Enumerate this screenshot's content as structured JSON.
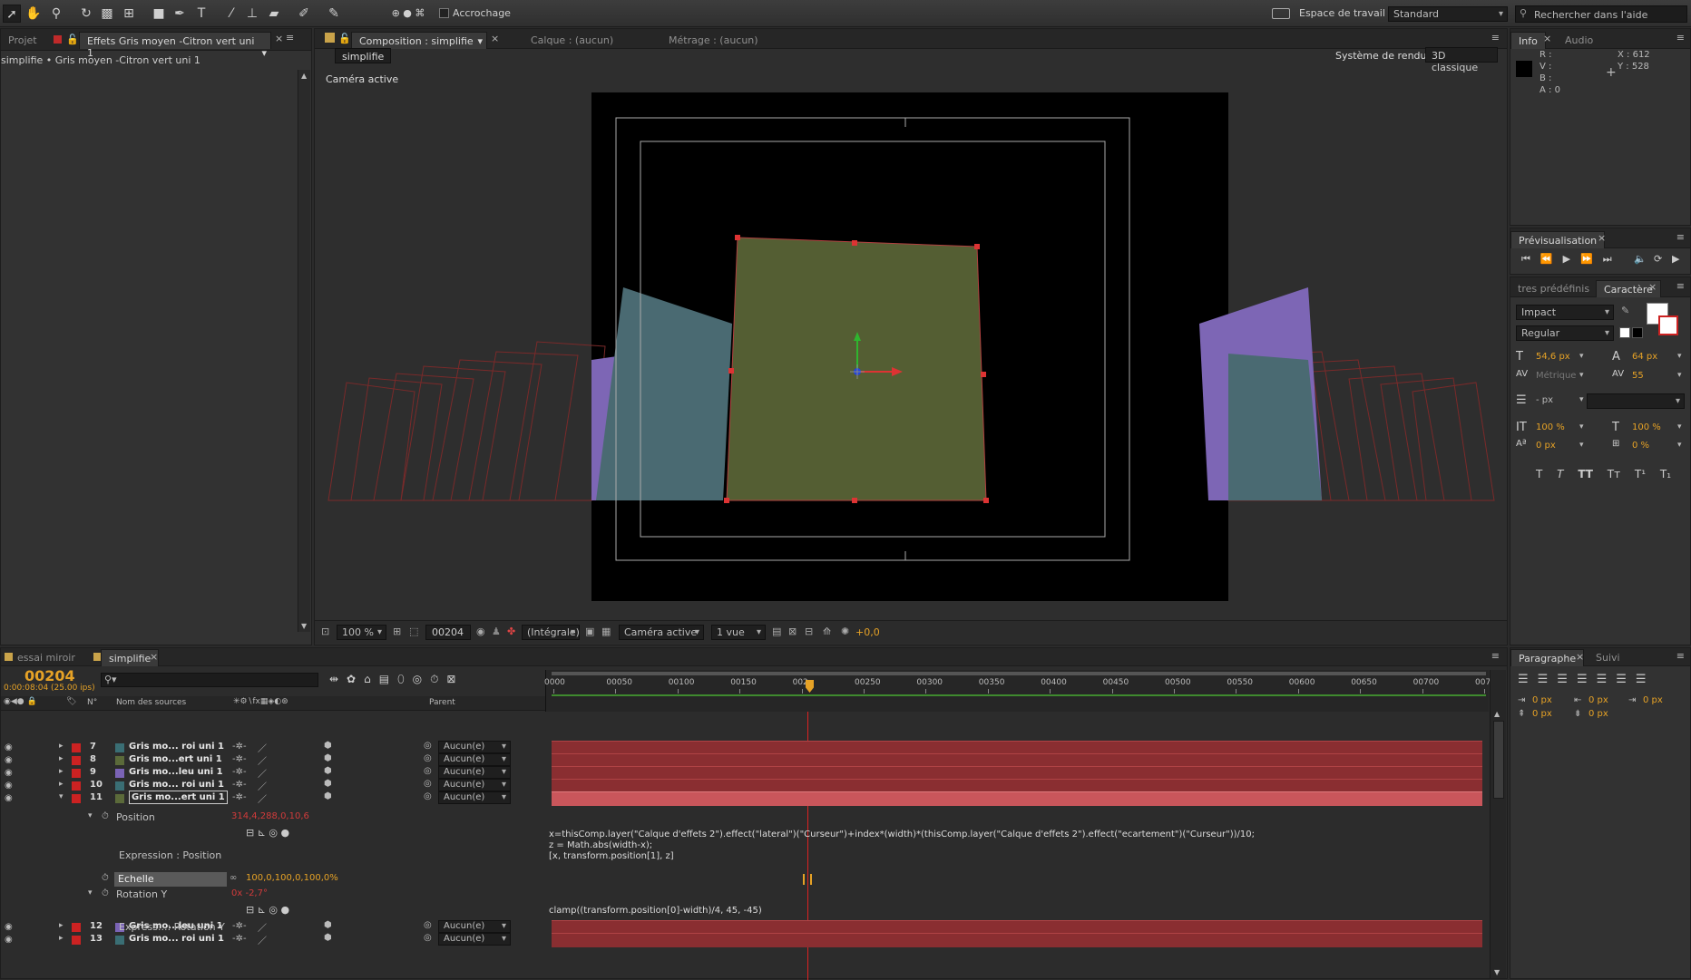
{
  "toolbar": {
    "snap_label": "Accrochage",
    "workspace_label": "Espace de travail :",
    "workspace_value": "Standard",
    "help_placeholder": "Rechercher dans l'aide"
  },
  "project": {
    "tab_projet": "Projet",
    "tab_effects": "Effets Gris moyen -Citron vert uni 1",
    "breadcrumb": "simplifie • Gris moyen -Citron vert uni 1"
  },
  "comp": {
    "tab_comp": "Composition : simplifie",
    "tab_layer": "Calque : (aucun)",
    "tab_footage": "Métrage : (aucun)",
    "subtab": "simplifie",
    "renderer_label": "Système de rendu :",
    "renderer_value": "3D classique",
    "camera_label": "Caméra active",
    "footer": {
      "zoom": "100 %",
      "timecode": "00204",
      "resolution": "(Intégrale)",
      "camera": "Caméra active",
      "views": "1 vue",
      "exposure": "+0,0"
    }
  },
  "info": {
    "tab_info": "Info",
    "tab_audio": "Audio",
    "r": "R :",
    "v": "V :",
    "b": "B :",
    "a": "A : 0",
    "x": "X : 612",
    "y": "Y : 528"
  },
  "preview": {
    "tab": "Prévisualisation"
  },
  "character": {
    "tab_presets": "tres prédéfinis",
    "tab_char": "Caractère",
    "font": "Impact",
    "style": "Regular",
    "size": "54,6 px",
    "leading": "64 px",
    "kerning": "Métrique",
    "tracking": "55",
    "stroke": "- px",
    "vscale": "100 %",
    "hscale": "100 %",
    "baseline": "0 px",
    "tsume": "0 %"
  },
  "paragraph": {
    "tab": "Paragraphe",
    "tab_suivi": "Suivi",
    "indent1": "0 px",
    "indent2": "0 px",
    "indent3": "0 px",
    "space1": "0 px",
    "space2": "0 px"
  },
  "timeline": {
    "tab_essai": "essai miroir",
    "tab_simplifie": "simplifie",
    "timecode": "00204",
    "timecode_sub": "0:00:08:04 (25.00 ips)",
    "col_num": "N°",
    "col_name": "Nom des sources",
    "col_parent": "Parent",
    "ruler": [
      "0000",
      "00050",
      "00100",
      "00150",
      "002",
      "00250",
      "00300",
      "00350",
      "00400",
      "00450",
      "00500",
      "00550",
      "00600",
      "00650",
      "00700",
      "0075"
    ],
    "layers": [
      {
        "num": "7",
        "name": "Gris mo... roi uni 1",
        "color": "#3a6e74",
        "parent": "Aucun(e)"
      },
      {
        "num": "8",
        "name": "Gris mo...ert uni 1",
        "color": "#5b6a3a",
        "parent": "Aucun(e)"
      },
      {
        "num": "9",
        "name": "Gris mo...leu uni 1",
        "color": "#7a63b5",
        "parent": "Aucun(e)"
      },
      {
        "num": "10",
        "name": "Gris mo... roi uni 1",
        "color": "#3a6e74",
        "parent": "Aucun(e)"
      },
      {
        "num": "11",
        "name": "Gris mo...ert uni 1",
        "color": "#5b6a3a",
        "parent": "Aucun(e)"
      },
      {
        "num": "12",
        "name": "Gris mo...leu uni 1",
        "color": "#7a63b5",
        "parent": "Aucun(e)"
      },
      {
        "num": "13",
        "name": "Gris mo... roi uni 1",
        "color": "#3a6e74",
        "parent": "Aucun(e)"
      }
    ],
    "prop_position": "Position",
    "prop_position_val": "314,4,288,0,10,6",
    "expr_position_label": "Expression : Position",
    "expr_position_lines": [
      "x=thisComp.layer(\"Calque d'effets 2\").effect(\"lateral\")(\"Curseur\")+index*(width)*(thisComp.layer(\"Calque d'effets 2\").effect(\"ecartement\")(\"Curseur\"))/10;",
      "z = Math.abs(width-x);",
      "[x, transform.position[1], z]"
    ],
    "prop_echelle": "Echelle",
    "prop_echelle_val": "100,0,100,0,100,0%",
    "prop_rotation": "Rotation Y",
    "prop_rotation_val": "0x -2,7°",
    "expr_rotation_label": "Express...: Rotation Y",
    "expr_rotation_line": "clamp((transform.position[0]-width)/4, 45, -45)"
  }
}
